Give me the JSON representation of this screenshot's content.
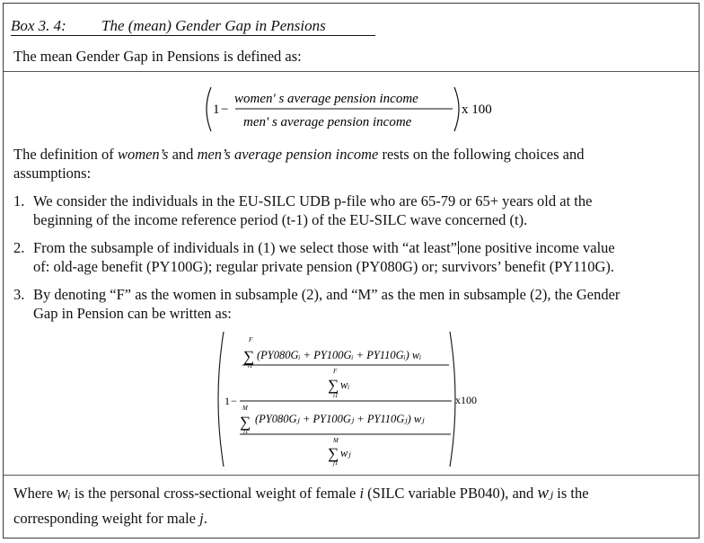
{
  "box": {
    "number": "Box 3. 4:",
    "title": "The (mean) Gender Gap in Pensions"
  },
  "intro": "The mean Gender Gap in Pensions is defined as:",
  "formula1": {
    "one": "1",
    "minus": "−",
    "numerator": "women' s average pension income",
    "denominator": "men' s average pension income",
    "times": "x 100"
  },
  "definition": {
    "part1": "The definition of ",
    "term1": "women’s",
    "part2": " and ",
    "term2": "men’s average pension income",
    "part3": " rests on the following choices and",
    "line2": "assumptions:"
  },
  "items": [
    {
      "num": "1.",
      "line1": "We consider the individuals in the EU-SILC UDB p-file who are 65-79 or 65+ years old at the",
      "line2": "beginning of the income reference period (t-1) of the EU-SILC wave concerned (t)."
    },
    {
      "num": "2.",
      "line1a": "From the subsample of individuals in (1) we select those with “at least”",
      "line1b": "one positive income value",
      "line2": "of: old-age benefit (PY100G); regular private pension (PY080G) or; survivors’ benefit (PY110G)."
    },
    {
      "num": "3.",
      "line1": "By denoting “F” as the women in subsample (2), and “M” as the men in subsample (2), the Gender",
      "line2": "Gap in Pension can be written as:"
    }
  ],
  "formula2": {
    "one": "1",
    "minus": "−",
    "sum": "∑",
    "sum_upper_f": "F",
    "sum_upper_m": "M",
    "sum_lower_i": "i1",
    "sum_lower_j": "j1",
    "num_top": "(PY080Gᵢ + PY100Gᵢ + PY110Gᵢ) wᵢ",
    "w_i": "wᵢ",
    "num_bottom": "(PY080Gⱼ + PY100Gⱼ + PY110Gⱼ) wⱼ",
    "w_j": "wⱼ",
    "times": "x100"
  },
  "footer": {
    "part1": "Where ",
    "w_i": "wᵢ",
    "part2": " is the personal cross-sectional weight of female ",
    "i": "i",
    "part3": " (SILC variable PB040), and ",
    "w_j": "wⱼ",
    "part4": " is the",
    "line2a": "corresponding weight for male ",
    "j": "j",
    "line2b": "."
  }
}
